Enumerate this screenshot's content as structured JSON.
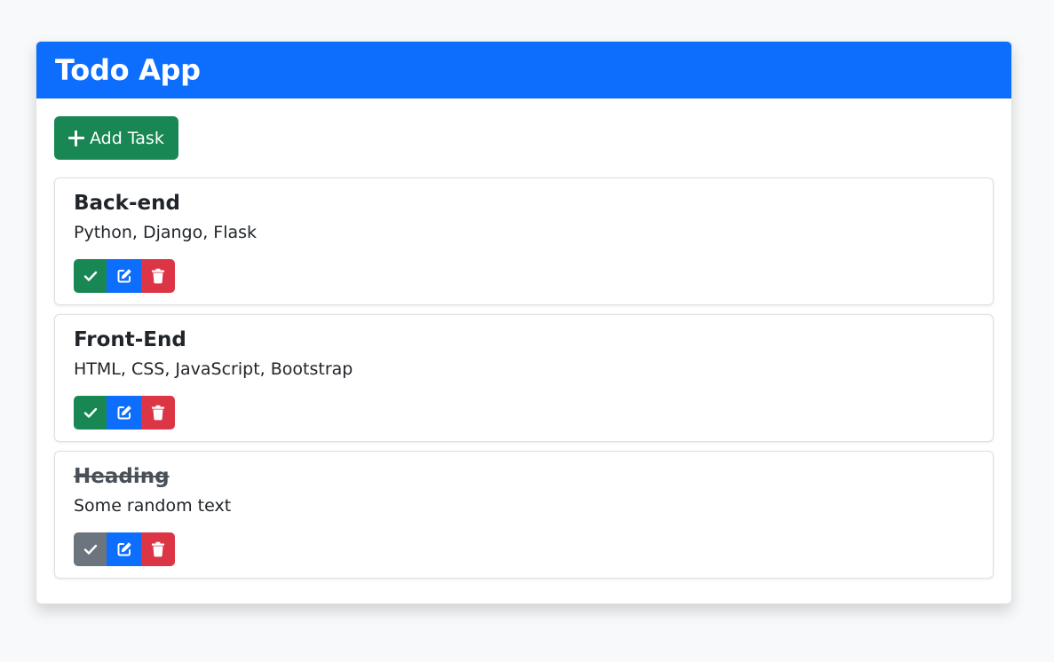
{
  "app": {
    "title": "Todo App",
    "add_button_label": "Add Task"
  },
  "colors": {
    "header": "#0d6efd",
    "success": "#198754",
    "secondary": "#6c757d",
    "danger": "#dc3545"
  },
  "tasks": [
    {
      "title": "Back-end",
      "description": "Python, Django, Flask",
      "completed": false,
      "icons": [
        "check-icon",
        "edit-icon",
        "trash-icon"
      ]
    },
    {
      "title": "Front-End",
      "description": "HTML, CSS, JavaScript, Bootstrap",
      "completed": false,
      "icons": [
        "check-icon",
        "edit-icon",
        "trash-icon"
      ]
    },
    {
      "title": "Heading",
      "description": "Some random text",
      "completed": true,
      "icons": [
        "check-icon",
        "edit-icon",
        "trash-icon"
      ]
    }
  ]
}
